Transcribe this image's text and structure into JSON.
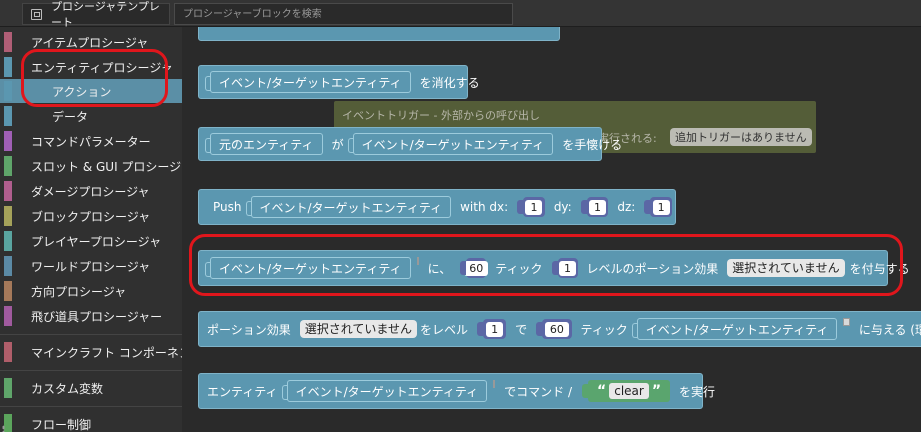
{
  "toolbar": {
    "template_tab": "プロシージャテンプレート",
    "search_placeholder": "プロシージャーブロックを検索"
  },
  "sidebar": {
    "items": [
      {
        "label": "アイテムプロシージャ",
        "color": "#b05e76"
      },
      {
        "label": "エンティティプロシージャ",
        "color": "#5b97b0"
      },
      {
        "label": "アクション",
        "color": "#5b97b0"
      },
      {
        "label": "データ",
        "color": "#5b97b0"
      },
      {
        "label": "コマンドパラメーター",
        "color": "#a05fb5"
      },
      {
        "label": "スロット & GUI プロシージャ",
        "color": "#5fa56a"
      },
      {
        "label": "ダメージプロシージャ",
        "color": "#b05e8e"
      },
      {
        "label": "ブロックプロシージャ",
        "color": "#a5a25a"
      },
      {
        "label": "プレイヤープロシージャ",
        "color": "#5aa5a0"
      },
      {
        "label": "ワールドプロシージャ",
        "color": "#5b8aa5"
      },
      {
        "label": "方向プロシージャ",
        "color": "#a5795a"
      },
      {
        "label": "飛び道具プロシージャー",
        "color": "#a05a9e"
      },
      {
        "label": "マインクラフト コンポーネント",
        "color": "#b05e6a"
      },
      {
        "label": "カスタム変数",
        "color": "#5fa56a"
      },
      {
        "label": "フロー制御",
        "color": "#5ba55c"
      }
    ]
  },
  "blocks": {
    "extinguish": {
      "entity": "イベント/ターゲットエンティティ",
      "suffix": "を消化する"
    },
    "trigger": {
      "title": "イベントトリガー - 外部からの呼び出し",
      "executed": "実行される:",
      "none": "追加トリガーはありません"
    },
    "tame": {
      "source": "元のエンティティ",
      "by": "が",
      "entity": "イベント/ターゲットエンティティ",
      "suffix": "を手懐ける"
    },
    "push": {
      "label": "Push",
      "entity": "イベント/ターゲットエンティティ",
      "dx_label": "with dx:",
      "dx": "1",
      "dy_label": "dy:",
      "dy": "1",
      "dz_label": "dz:",
      "dz": "1"
    },
    "potion_to": {
      "entity": "イベント/ターゲットエンティティ",
      "ni": "に、",
      "ticks": "60",
      "tick_label": "ティック",
      "level": "1",
      "effect_label": "レベルのポーション効果",
      "effect": "選択されていません",
      "suffix": "を付与する"
    },
    "potion_give": {
      "prefix": "ポーション効果",
      "effect": "選択されていません",
      "level_label": "をレベル",
      "level": "1",
      "de": "で",
      "ticks": "60",
      "tick_label": "ティック",
      "entity": "イベント/ターゲットエンティティ",
      "suffix": "に与える (環境に"
    },
    "command": {
      "prefix": "エンティティ",
      "entity": "イベント/ターゲットエンティティ",
      "mid": "でコマンド /",
      "open_quote": "“",
      "value": "clear",
      "close_quote": "”",
      "suffix": "を実行"
    }
  },
  "colors": {
    "entity_block": "#5b97b0",
    "number_block": "#5b67a5",
    "text_block": "#5aa56e",
    "highlight": "#e0161c"
  }
}
